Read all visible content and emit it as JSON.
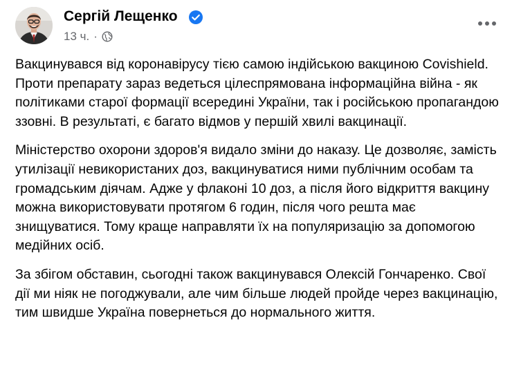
{
  "post": {
    "author": "Сергій Лещенко",
    "time": "13 ч.",
    "separator": "·",
    "icons": {
      "verified": "verified-badge-icon",
      "privacy": "globe-icon",
      "more": "more-horizontal-icon"
    },
    "colors": {
      "verified_badge": "#1877f2",
      "meta_text": "#65676b",
      "body_text": "#050505"
    },
    "paragraphs": [
      "Вакцинувався від коронавірусу тією самою індійською вакциною Covishield. Проти препарату зараз ведеться цілеспрямована інформаційна війна - як політиками старої формації всередині України, так і російською пропагандою ззовні. В результаті, є багато відмов у першій хвилі вакцинації.",
      "Міністерство охорони здоров'я видало зміни до наказу. Це дозволяє, замість утилізації невикористаних доз, вакцинуватися ними публічним особам та громадським діячам. Адже у флаконі 10 доз, а після його відкриття вакцину можна використовувати протягом 6 годин, після чого решта має знищуватися. Тому краще направляти їх на популяризацію за допомогою медійних осіб.",
      "За збігом обставин, сьогодні також вакцинувався Олексій Гончаренко. Свої дії ми ніяк не погоджували, але чим більше людей пройде через вакцинацію, тим швидше Україна повернеться до нормального життя."
    ]
  }
}
